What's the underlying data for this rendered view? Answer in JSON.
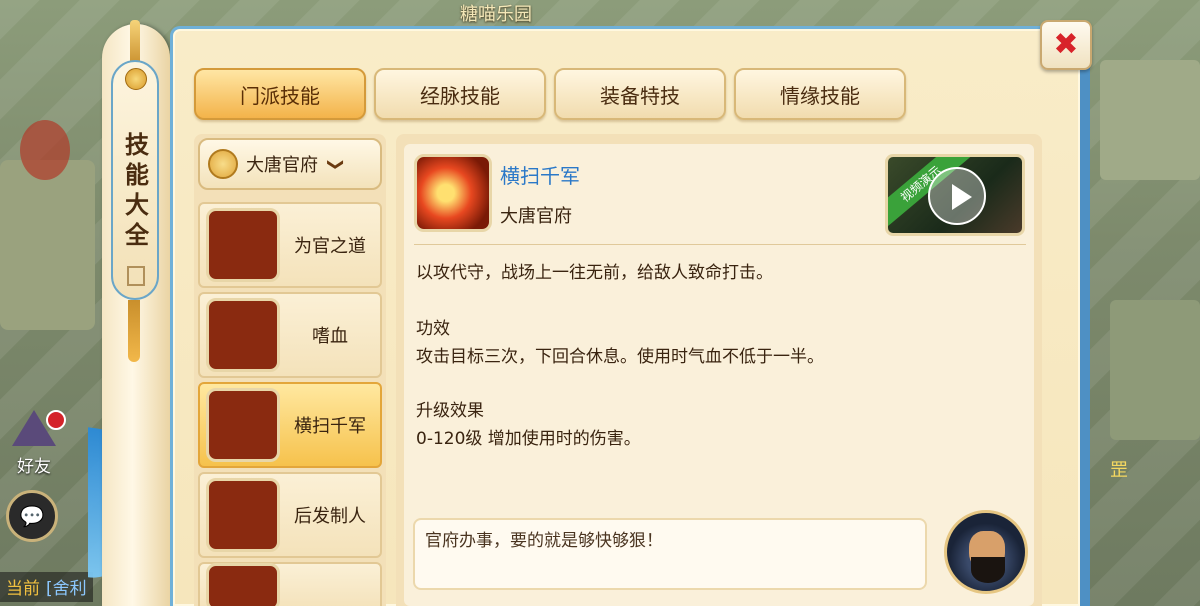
{
  "scene": {
    "top_label": "糖喵乐园",
    "right_text": "罡"
  },
  "hud": {
    "friends_label": "好友",
    "chat_icon": "chat-bubble-icon",
    "bottom_chat": {
      "current": "当前",
      "channel": "[舍利"
    }
  },
  "scroll": {
    "title": "技能大全",
    "seal": "印"
  },
  "close_label": "✖",
  "tabs": [
    {
      "label": "门派技能",
      "active": true
    },
    {
      "label": "经脉技能",
      "active": false
    },
    {
      "label": "装备特技",
      "active": false
    },
    {
      "label": "情缘技能",
      "active": false
    }
  ],
  "school_selector": {
    "name": "大唐官府",
    "chevron": "❯"
  },
  "skills": [
    {
      "label": "为官之道",
      "icon": "official-way-icon"
    },
    {
      "label": "嗜血",
      "icon": "bloodthirst-icon"
    },
    {
      "label": "横扫千军",
      "icon": "sweep-army-icon",
      "selected": true
    },
    {
      "label": "后发制人",
      "icon": "counter-strike-icon"
    },
    {
      "label": "",
      "icon": "skill-partial-icon"
    }
  ],
  "detail": {
    "name": "横扫千军",
    "school": "大唐官府",
    "video_tag": "视频演示",
    "intro": "以攻代守，战场上一往无前，给敌人致命打击。",
    "effect_title": "功效",
    "effect_text": "攻击目标三次，下回合休息。使用时气血不低于一半。",
    "upgrade_title": "升级效果",
    "upgrade_text": "0-120级 增加使用时的伤害。",
    "quote": "官府办事，要的就是够快够狠！"
  }
}
